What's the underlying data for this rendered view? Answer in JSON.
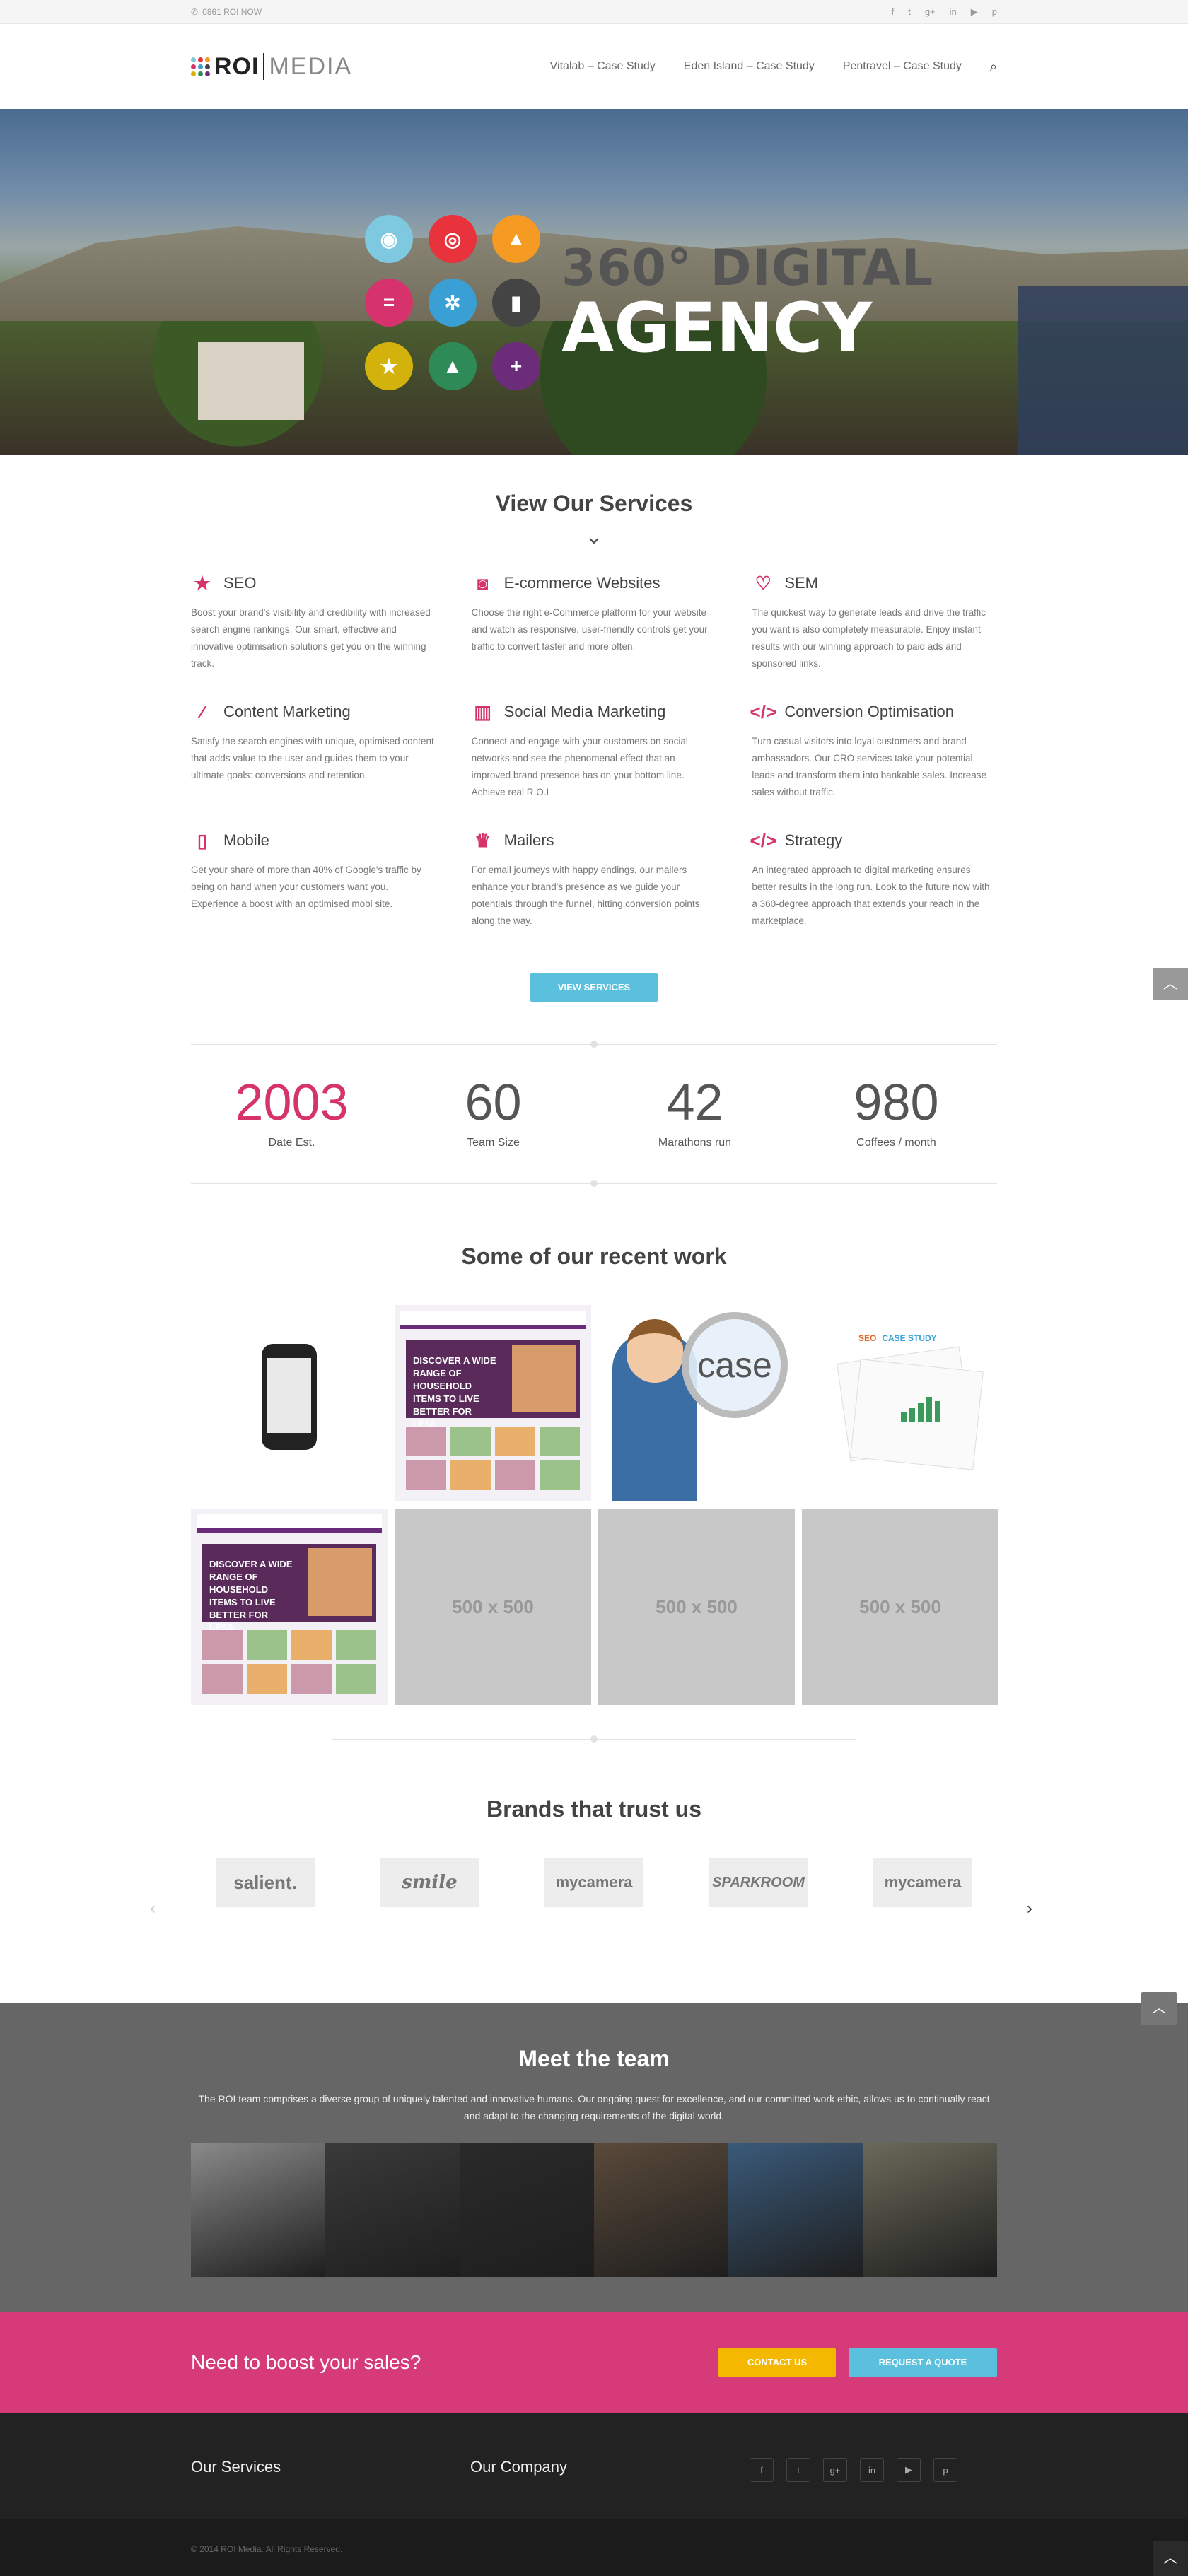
{
  "topbar": {
    "phone": "0861 ROI NOW",
    "social_icons": [
      "facebook-icon",
      "twitter-icon",
      "google-plus-icon",
      "linkedin-icon",
      "youtube-icon",
      "pinterest-icon"
    ],
    "social_glyphs": [
      "f",
      "t",
      "g+",
      "in",
      "▶",
      "p"
    ]
  },
  "header": {
    "logo_roi": "ROI",
    "logo_media": "MEDIA",
    "nav": [
      "Vitalab – Case Study",
      "Eden Island – Case Study",
      "Pentravel – Case Study"
    ]
  },
  "hero": {
    "line1": "360° DIGITAL",
    "line2": "AGENCY",
    "circles": [
      {
        "color": "#7ec9e0",
        "icon": "eye-icon",
        "glyph": "◉"
      },
      {
        "color": "#e8323c",
        "icon": "target-icon",
        "glyph": "◎"
      },
      {
        "color": "#f59a23",
        "icon": "triangle-icon",
        "glyph": "▲"
      },
      {
        "color": "#d6336c",
        "icon": "bars-icon",
        "glyph": "="
      },
      {
        "color": "#3a9fd5",
        "icon": "network-icon",
        "glyph": "✲"
      },
      {
        "color": "#444444",
        "icon": "mobile-icon",
        "glyph": "▮"
      },
      {
        "color": "#d4b20c",
        "icon": "star-icon",
        "glyph": "★"
      },
      {
        "color": "#2e8b57",
        "icon": "arrow-up-icon",
        "glyph": "▲"
      },
      {
        "color": "#6b2d7a",
        "icon": "plus-icon",
        "glyph": "+"
      }
    ]
  },
  "services": {
    "title": "View Our Services",
    "items": [
      {
        "title": "SEO",
        "icon": "star-icon",
        "glyph": "★",
        "text": "Boost your brand's visibility and credibility with increased search engine rankings. Our smart, effective and innovative optimisation solutions get you on the winning track."
      },
      {
        "title": "E-commerce Websites",
        "icon": "camera-icon",
        "glyph": "◙",
        "text": "Choose the right e-Commerce platform for your website and watch as responsive, user-friendly controls get your traffic to convert faster and more often."
      },
      {
        "title": "SEM",
        "icon": "heart-icon",
        "glyph": "♡",
        "text": "The quickest way to generate leads and drive the traffic you want is also completely measurable. Enjoy instant results with our winning approach to paid ads and sponsored links."
      },
      {
        "title": "Content Marketing",
        "icon": "magic-wand-icon",
        "glyph": "⁄",
        "text": "Satisfy the search engines with unique, optimised content that adds value to the user and guides them to your ultimate goals: conversions and retention."
      },
      {
        "title": "Social Media Marketing",
        "icon": "bar-chart-icon",
        "glyph": "▥",
        "text": "Connect and engage with your customers on social networks and see the phenomenal effect that an improved brand presence has on your bottom line. Achieve real R.O.I"
      },
      {
        "title": "Conversion Optimisation",
        "icon": "code-icon",
        "glyph": "</>",
        "text": "Turn casual visitors into loyal customers and brand ambassadors. Our CRO services take your potential leads and transform them into bankable sales. Increase sales without traffic."
      },
      {
        "title": "Mobile",
        "icon": "mobile-icon",
        "glyph": "▯",
        "text": "Get your share of more than 40% of Google's traffic by being on hand when your customers want you. Experience a boost with an optimised mobi site."
      },
      {
        "title": "Mailers",
        "icon": "trophy-icon",
        "glyph": "♛",
        "text": "For email journeys with happy endings, our mailers enhance your brand's presence as we guide your potentials through the funnel, hitting conversion points along the way."
      },
      {
        "title": "Strategy",
        "icon": "code-icon",
        "glyph": "</>",
        "text": "An integrated approach to digital marketing ensures better results in the long run. Look to the future now with a 360-degree approach that extends your reach in the marketplace."
      }
    ],
    "button": "VIEW SERVICES"
  },
  "stats": [
    {
      "value": "2003",
      "label": "Date Est.",
      "color": "#d6336c"
    },
    {
      "value": "60",
      "label": "Team Size",
      "color": "#555555"
    },
    {
      "value": "42",
      "label": "Marathons run",
      "color": "#555555"
    },
    {
      "value": "980",
      "label": "Coffees / month",
      "color": "#555555"
    }
  ],
  "work": {
    "title": "Some of our recent work",
    "site_banner": "DISCOVER A WIDE RANGE OF HOUSEHOLD ITEMS TO LIVE BETTER FOR LESS.",
    "case_word": "case",
    "seo_label": "SEO",
    "seo_case": "CASE STUDY",
    "placeholder": "500 x 500"
  },
  "brands": {
    "title": "Brands that trust us",
    "items": [
      "salient.",
      "smile",
      "mycamera",
      "SPARKROOM",
      "mycamera"
    ]
  },
  "team": {
    "title": "Meet the team",
    "text": "The ROI team comprises a diverse group of uniquely talented and innovative humans. Our ongoing quest for excellence, and our committed work ethic, allows us to continually react and adapt to the changing requirements of the digital world.",
    "photo_tones": [
      "#8a8a8a",
      "#3a3a3a",
      "#2a2a2a",
      "#5a4a3a",
      "#3a5a7a",
      "#6a6a5a"
    ]
  },
  "cta": {
    "text": "Need to boost your sales?",
    "contact": "CONTACT US",
    "quote": "REQUEST A QUOTE"
  },
  "footer": {
    "col1": "Our Services",
    "col2": "Our Company",
    "social_glyphs": [
      "f",
      "t",
      "g+",
      "in",
      "▶",
      "p"
    ],
    "copyright": "© 2014 ROI Media. All Rights Reserved."
  },
  "colors": {
    "accent": "#d6336c",
    "button_blue": "#5bc0de",
    "button_yellow": "#f5b800"
  }
}
